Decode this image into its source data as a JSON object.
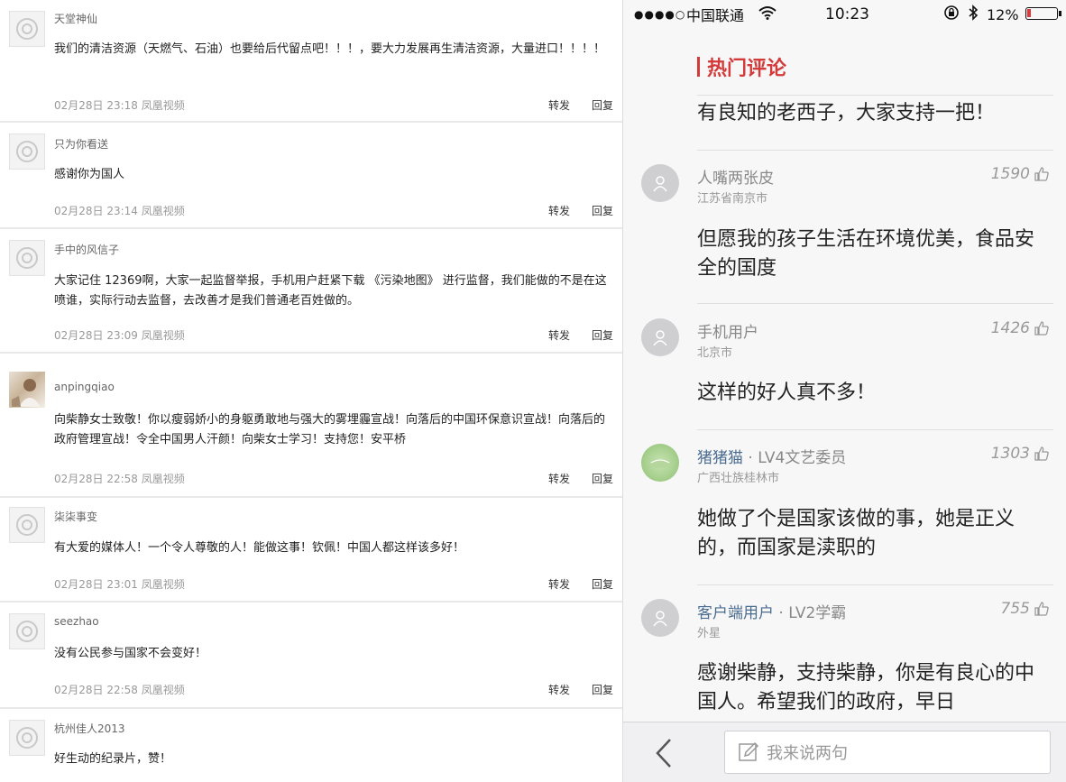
{
  "left_comments": [
    {
      "name": "天堂神仙",
      "text": "我们的清洁资源（天燃气、石油）也要给后代留点吧！！！，要大力发展再生清洁资源，大量进口！！！！",
      "meta": "02月28日 23:18 凤凰视频",
      "forward": "转发",
      "reply": "回复"
    },
    {
      "name": "只为你看送",
      "text": "感谢你为国人",
      "meta": "02月28日 23:14 凤凰视频",
      "forward": "转发",
      "reply": "回复"
    },
    {
      "name": "手中的风信子",
      "text": "大家记住 12369啊，大家一起监督举报，手机用户赶紧下载 《污染地图》 进行监督，我们能做的不是在这喷谁，实际行动去监督，去改善才是我们普通老百姓做的。",
      "meta": "02月28日 23:09 凤凰视频",
      "forward": "转发",
      "reply": "回复"
    },
    {
      "name": "anpingqiao",
      "text": "向柴静女士致敬！你以瘦弱娇小的身躯勇敢地与强大的雾埋霾宣战！向落后的中国环保意识宣战！向落后的政府管理宣战！令全中国男人汗颜！向柴女士学习！支持您！安平桥",
      "meta": "02月28日 22:58 凤凰视频",
      "forward": "转发",
      "reply": "回复"
    },
    {
      "name": "柒柒事变",
      "text": "有大爱的媒体人！一个令人尊敬的人！能做这事！钦佩！中国人都这样该多好！",
      "meta": "02月28日 23:01 凤凰视频",
      "forward": "转发",
      "reply": "回复"
    },
    {
      "name": "seezhao",
      "text": "没有公民参与国家不会变好！",
      "meta": "02月28日 22:58 凤凰视频",
      "forward": "转发",
      "reply": "回复"
    },
    {
      "name": "杭州佳人2013",
      "text": "好生动的纪录片，赞！",
      "meta": "",
      "forward": "",
      "reply": ""
    }
  ],
  "status_bar": {
    "signal": "●●●●○",
    "carrier": "中国联通",
    "time": "10:23",
    "battery_pct": "12%",
    "battery_level": 0.12,
    "battery_color": "#e23a3a"
  },
  "hot_section_title": "热门评论",
  "top_text": "有良知的老西子，大家支持一把！",
  "right_comments": [
    {
      "name": "人嘴两张皮",
      "level": "",
      "location": "江苏省南京市",
      "likes": "1590",
      "text": "但愿我的孩子生活在环境优美，食品安全的国度"
    },
    {
      "name": "手机用户",
      "level": "",
      "location": "北京市",
      "likes": "1426",
      "text": "这样的好人真不多！"
    },
    {
      "name": "猪猪猫",
      "level": " · LV4文艺委员",
      "location": "广西壮族桂林市",
      "likes": "1303",
      "text": "她做了个是国家该做的事，她是正义的，而国家是渎职的"
    },
    {
      "name": "客户端用户",
      "level": " · LV2学霸",
      "location": "外星",
      "likes": "755",
      "text": "感谢柴静，支持柴静，你是有良心的中国人。希望我们的政府，早日"
    }
  ],
  "input_placeholder": "我来说两句",
  "accent_color": "#d33b3b"
}
